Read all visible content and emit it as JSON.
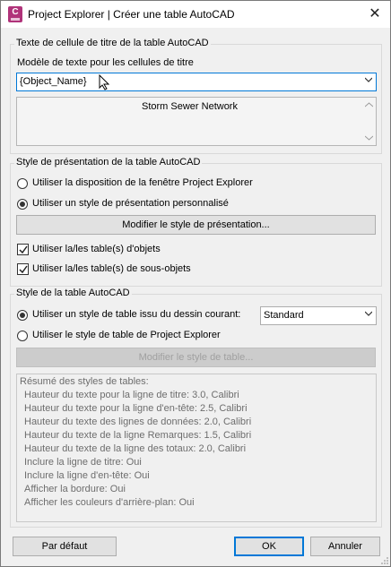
{
  "window": {
    "title": "Project Explorer | Créer une table AutoCAD",
    "app_icon_letter": "C",
    "close_glyph": "✕"
  },
  "title_cell_group": {
    "title": "Texte de cellule de titre de la table AutoCAD",
    "template_label": "Modèle de texte pour les cellules de titre",
    "template_value": "{Object_Name}",
    "preview_text": "Storm Sewer Network"
  },
  "presentation_group": {
    "title": "Style de présentation de la table AutoCAD",
    "option_window_layout": "Utiliser la disposition de la fenêtre Project Explorer",
    "option_custom_style": "Utiliser un style de présentation personnalisé",
    "selected_option": "custom",
    "modify_button": "Modifier le style de présentation...",
    "check_object_tables": "Utiliser la/les table(s) d'objets",
    "check_subobject_tables": "Utiliser la/les table(s) de sous-objets",
    "object_tables_checked": true,
    "subobject_tables_checked": true
  },
  "table_style_group": {
    "title": "Style de la table AutoCAD",
    "option_current_drawing": "Utiliser un style de table issu du dessin courant:",
    "option_project_explorer": "Utiliser le style de table de Project Explorer",
    "selected_option": "current_drawing",
    "style_dropdown_value": "Standard",
    "modify_button": "Modifier le style de table...",
    "summary_heading": "Résumé des styles de tables:",
    "summary_lines": [
      "Hauteur du texte pour la ligne de titre: 3.0, Calibri",
      "Hauteur du texte pour la ligne d'en-tête: 2.5, Calibri",
      "Hauteur du texte des lignes de données: 2.0, Calibri",
      "Hauteur du texte de la ligne Remarques: 1.5, Calibri",
      "Hauteur du texte de la ligne des totaux: 2.0, Calibri",
      "Inclure la ligne de titre: Oui",
      "Inclure la ligne d'en-tête: Oui",
      "Afficher la bordure: Oui",
      "Afficher les couleurs d'arrière-plan: Oui"
    ]
  },
  "footer": {
    "default_button": "Par défaut",
    "ok_button": "OK",
    "cancel_button": "Annuler"
  },
  "colors": {
    "accent": "#0078d7",
    "app_icon": "#b0337a"
  }
}
